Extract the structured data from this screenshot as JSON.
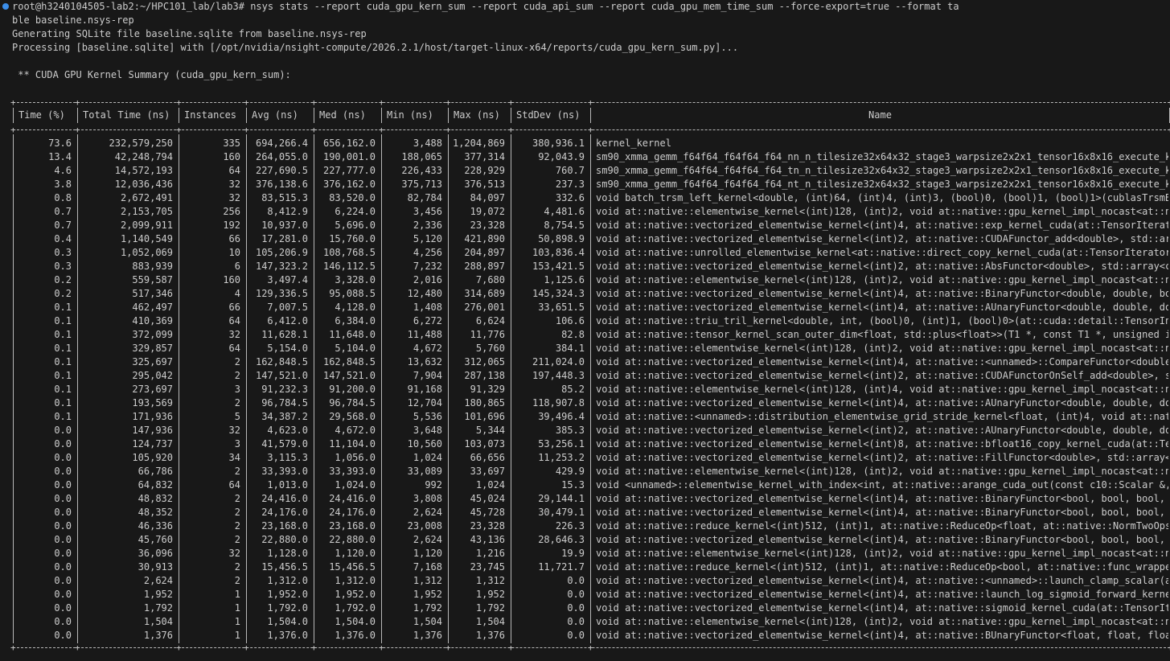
{
  "terminal": {
    "command_line_1": "root@h3240104505-lab2:~/HPC101_lab/lab3# nsys stats --report cuda_gpu_kern_sum --report cuda_api_sum --report cuda_gpu_mem_time_sum --force-export=true --format ta",
    "command_line_2": "ble baseline.nsys-rep",
    "output_line_1": "Generating SQLite file baseline.sqlite from baseline.nsys-rep",
    "output_line_2": "Processing [baseline.sqlite] with [/opt/nvidia/nsight-compute/2026.2.1/host/target-linux-x64/reports/cuda_gpu_kern_sum.py]...",
    "section_title": " ** CUDA GPU Kernel Summary (cuda_gpu_kern_sum):"
  },
  "table": {
    "headers": [
      "Time (%)",
      "Total Time (ns)",
      "Instances",
      "Avg (ns)",
      "Med (ns)",
      "Min (ns)",
      "Max (ns)",
      "StdDev (ns)",
      "Name"
    ],
    "rows": [
      [
        "73.6",
        "232,579,250",
        "335",
        "694,266.4",
        "656,162.0",
        "3,488",
        "1,204,869",
        "380,936.1",
        "kernel_kernel"
      ],
      [
        "13.4",
        "42,248,794",
        "160",
        "264,055.0",
        "190,001.0",
        "188,065",
        "377,314",
        "92,043.9",
        "sm90_xmma_gemm_f64f64_f64f64_f64_nn_n_tilesize32x64x32_stage3_warpsize2x2x1_tensor16x8x16_execute_k…"
      ],
      [
        "4.6",
        "14,572,193",
        "64",
        "227,690.5",
        "227,777.0",
        "226,433",
        "228,929",
        "760.7",
        "sm90_xmma_gemm_f64f64_f64f64_f64_tn_n_tilesize32x64x32_stage3_warpsize2x2x1_tensor16x8x16_execute_k…"
      ],
      [
        "3.8",
        "12,036,436",
        "32",
        "376,138.6",
        "376,162.0",
        "375,713",
        "376,513",
        "237.3",
        "sm90_xmma_gemm_f64f64_f64f64_f64_nt_n_tilesize32x64x32_stage3_warpsize2x2x1_tensor16x8x16_execute_k…"
      ],
      [
        "0.8",
        "2,672,491",
        "32",
        "83,515.3",
        "83,520.0",
        "82,784",
        "84,097",
        "332.6",
        "void batch_trsm_left_kernel<double, (int)64, (int)4, (int)3, (bool)0, (bool)1, (bool)1>(cublasTrsmB…"
      ],
      [
        "0.7",
        "2,153,705",
        "256",
        "8,412.9",
        "6,224.0",
        "3,456",
        "19,072",
        "4,481.6",
        "void at::native::elementwise_kernel<(int)128, (int)2, void at::native::gpu_kernel_impl_nocast<at::n…"
      ],
      [
        "0.7",
        "2,099,911",
        "192",
        "10,937.0",
        "5,696.0",
        "2,336",
        "23,328",
        "8,754.5",
        "void at::native::vectorized_elementwise_kernel<(int)4, at::native::exp_kernel_cuda(at::TensorIterat…"
      ],
      [
        "0.4",
        "1,140,549",
        "66",
        "17,281.0",
        "15,760.0",
        "5,120",
        "421,890",
        "50,898.9",
        "void at::native::vectorized_elementwise_kernel<(int)2, at::native::CUDAFunctor_add<double>, std::ar…"
      ],
      [
        "0.3",
        "1,052,069",
        "10",
        "105,206.9",
        "108,768.5",
        "4,256",
        "204,897",
        "103,836.4",
        "void at::native::unrolled_elementwise_kernel<at::native::direct_copy_kernel_cuda(at::TensorIterator…"
      ],
      [
        "0.3",
        "883,939",
        "6",
        "147,323.2",
        "146,112.5",
        "7,232",
        "288,897",
        "153,421.5",
        "void at::native::vectorized_elementwise_kernel<(int)2, at::native::AbsFunctor<double>, std::array<c…"
      ],
      [
        "0.2",
        "559,587",
        "160",
        "3,497.4",
        "3,328.0",
        "2,016",
        "7,680",
        "1,125.6",
        "void at::native::elementwise_kernel<(int)128, (int)2, void at::native::gpu_kernel_impl_nocast<at::n…"
      ],
      [
        "0.2",
        "517,346",
        "4",
        "129,336.5",
        "95,088.5",
        "12,480",
        "314,689",
        "145,324.3",
        "void at::native::vectorized_elementwise_kernel<(int)4, at::native::BinaryFunctor<double, double, bo…"
      ],
      [
        "0.1",
        "462,497",
        "66",
        "7,007.5",
        "4,128.0",
        "1,408",
        "276,001",
        "33,651.5",
        "void at::native::vectorized_elementwise_kernel<(int)4, at::native::AUnaryFunctor<double, double, do…"
      ],
      [
        "0.1",
        "410,369",
        "64",
        "6,412.0",
        "6,384.0",
        "6,272",
        "6,624",
        "106.6",
        "void at::native::triu_tril_kernel<double, int, (bool)0, (int)1, (bool)0>(at::cuda::detail::TensorIn…"
      ],
      [
        "0.1",
        "372,099",
        "32",
        "11,628.1",
        "11,648.0",
        "11,488",
        "11,776",
        "82.8",
        "void at::native::tensor_kernel_scan_outer_dim<float, std::plus<float>>(T1 *, const T1 *, unsigned i…"
      ],
      [
        "0.1",
        "329,857",
        "64",
        "5,154.0",
        "5,104.0",
        "4,672",
        "5,760",
        "384.1",
        "void at::native::elementwise_kernel<(int)128, (int)2, void at::native::gpu_kernel_impl_nocast<at::n…"
      ],
      [
        "0.1",
        "325,697",
        "2",
        "162,848.5",
        "162,848.5",
        "13,632",
        "312,065",
        "211,024.0",
        "void at::native::vectorized_elementwise_kernel<(int)4, at::native::<unnamed>::CompareFunctor<double…"
      ],
      [
        "0.1",
        "295,042",
        "2",
        "147,521.0",
        "147,521.0",
        "7,904",
        "287,138",
        "197,448.3",
        "void at::native::vectorized_elementwise_kernel<(int)2, at::native::CUDAFunctorOnSelf_add<double>, s…"
      ],
      [
        "0.1",
        "273,697",
        "3",
        "91,232.3",
        "91,200.0",
        "91,168",
        "91,329",
        "85.2",
        "void at::native::elementwise_kernel<(int)128, (int)4, void at::native::gpu_kernel_impl_nocast<at::n…"
      ],
      [
        "0.1",
        "193,569",
        "2",
        "96,784.5",
        "96,784.5",
        "12,704",
        "180,865",
        "118,907.8",
        "void at::native::vectorized_elementwise_kernel<(int)4, at::native::AUnaryFunctor<double, double, do…"
      ],
      [
        "0.1",
        "171,936",
        "5",
        "34,387.2",
        "29,568.0",
        "5,536",
        "101,696",
        "39,496.4",
        "void at::native::<unnamed>::distribution_elementwise_grid_stride_kernel<float, (int)4, void at::nat…"
      ],
      [
        "0.0",
        "147,936",
        "32",
        "4,623.0",
        "4,672.0",
        "3,648",
        "5,344",
        "385.3",
        "void at::native::vectorized_elementwise_kernel<(int)2, at::native::AUnaryFunctor<double, double, do…"
      ],
      [
        "0.0",
        "124,737",
        "3",
        "41,579.0",
        "11,104.0",
        "10,560",
        "103,073",
        "53,256.1",
        "void at::native::vectorized_elementwise_kernel<(int)8, at::native::bfloat16_copy_kernel_cuda(at::Te…"
      ],
      [
        "0.0",
        "105,920",
        "34",
        "3,115.3",
        "1,056.0",
        "1,024",
        "66,656",
        "11,253.2",
        "void at::native::vectorized_elementwise_kernel<(int)2, at::native::FillFunctor<double>, std::array<…"
      ],
      [
        "0.0",
        "66,786",
        "2",
        "33,393.0",
        "33,393.0",
        "33,089",
        "33,697",
        "429.9",
        "void at::native::elementwise_kernel<(int)128, (int)2, void at::native::gpu_kernel_impl_nocast<at::n…"
      ],
      [
        "0.0",
        "64,832",
        "64",
        "1,013.0",
        "1,024.0",
        "992",
        "1,024",
        "15.3",
        "void <unnamed>::elementwise_kernel_with_index<int, at::native::arange_cuda_out(const c10::Scalar &,…"
      ],
      [
        "0.0",
        "48,832",
        "2",
        "24,416.0",
        "24,416.0",
        "3,808",
        "45,024",
        "29,144.1",
        "void at::native::vectorized_elementwise_kernel<(int)4, at::native::BinaryFunctor<bool, bool, bool, …"
      ],
      [
        "0.0",
        "48,352",
        "2",
        "24,176.0",
        "24,176.0",
        "2,624",
        "45,728",
        "30,479.1",
        "void at::native::vectorized_elementwise_kernel<(int)4, at::native::BinaryFunctor<bool, bool, bool, …"
      ],
      [
        "0.0",
        "46,336",
        "2",
        "23,168.0",
        "23,168.0",
        "23,008",
        "23,328",
        "226.3",
        "void at::native::reduce_kernel<(int)512, (int)1, at::native::ReduceOp<float, at::native::NormTwoOps…"
      ],
      [
        "0.0",
        "45,760",
        "2",
        "22,880.0",
        "22,880.0",
        "2,624",
        "43,136",
        "28,646.3",
        "void at::native::vectorized_elementwise_kernel<(int)4, at::native::BinaryFunctor<bool, bool, bool, …"
      ],
      [
        "0.0",
        "36,096",
        "32",
        "1,128.0",
        "1,120.0",
        "1,120",
        "1,216",
        "19.9",
        "void at::native::elementwise_kernel<(int)128, (int)2, void at::native::gpu_kernel_impl_nocast<at::n…"
      ],
      [
        "0.0",
        "30,913",
        "2",
        "15,456.5",
        "15,456.5",
        "7,168",
        "23,745",
        "11,721.7",
        "void at::native::reduce_kernel<(int)512, (int)1, at::native::ReduceOp<bool, at::native::func_wrappe…"
      ],
      [
        "0.0",
        "2,624",
        "2",
        "1,312.0",
        "1,312.0",
        "1,312",
        "1,312",
        "0.0",
        "void at::native::vectorized_elementwise_kernel<(int)4, at::native::<unnamed>::launch_clamp_scalar(a…"
      ],
      [
        "0.0",
        "1,952",
        "1",
        "1,952.0",
        "1,952.0",
        "1,952",
        "1,952",
        "0.0",
        "void at::native::vectorized_elementwise_kernel<(int)4, at::native::launch_log_sigmoid_forward_kerne…"
      ],
      [
        "0.0",
        "1,792",
        "1",
        "1,792.0",
        "1,792.0",
        "1,792",
        "1,792",
        "0.0",
        "void at::native::vectorized_elementwise_kernel<(int)4, at::native::sigmoid_kernel_cuda(at::TensorIt…"
      ],
      [
        "0.0",
        "1,504",
        "1",
        "1,504.0",
        "1,504.0",
        "1,504",
        "1,504",
        "0.0",
        "void at::native::elementwise_kernel<(int)128, (int)2, void at::native::gpu_kernel_impl_nocast<at::n…"
      ],
      [
        "0.0",
        "1,376",
        "1",
        "1,376.0",
        "1,376.0",
        "1,376",
        "1,376",
        "0.0",
        "void at::native::vectorized_elementwise_kernel<(int)4, at::native::BUnaryFunctor<float, float, floa…"
      ]
    ]
  },
  "colors": {
    "background": "#181818",
    "foreground": "#cccccc",
    "prompt_dot": "#3b8eea"
  }
}
